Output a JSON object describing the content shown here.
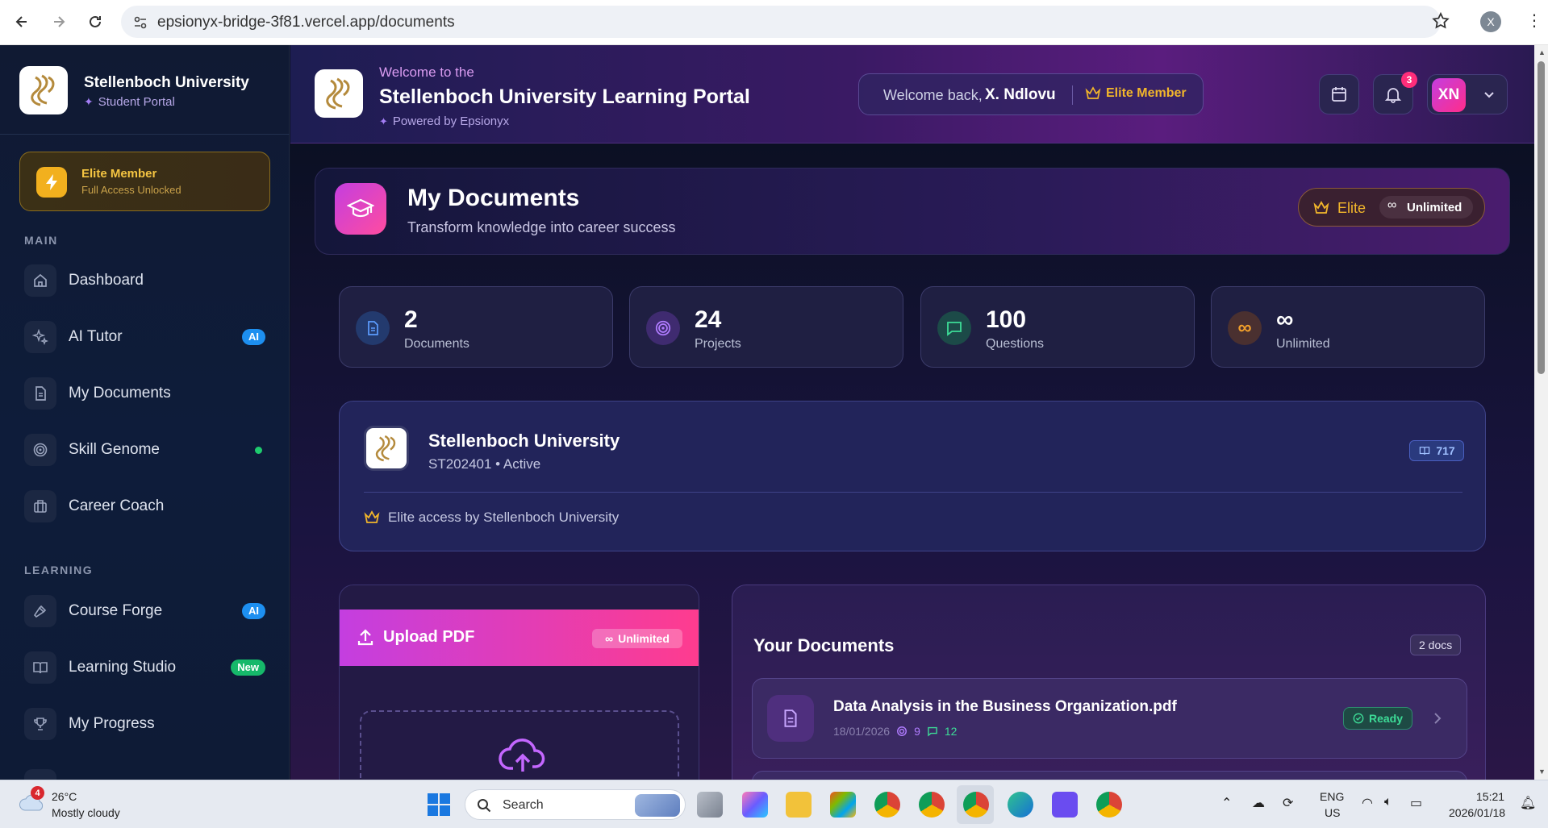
{
  "browser": {
    "url": "epsionyx-bridge-3f81.vercel.app/documents",
    "profile_initial": "X"
  },
  "sidebar": {
    "brand_name": "Stellenboch University",
    "brand_sub": "Student Portal",
    "elite_title": "Elite Member",
    "elite_sub": "Full Access Unlocked",
    "section_main": "MAIN",
    "section_learning": "LEARNING",
    "items": [
      {
        "label": "Dashboard"
      },
      {
        "label": "AI Tutor",
        "badge": "AI"
      },
      {
        "label": "My Documents"
      },
      {
        "label": "Skill Genome"
      },
      {
        "label": "Career Coach"
      },
      {
        "label": "Course Forge",
        "badge": "AI"
      },
      {
        "label": "Learning Studio",
        "badge": "New"
      },
      {
        "label": "My Progress"
      }
    ]
  },
  "header": {
    "welcome_to": "Welcome to the",
    "portal_title": "Stellenboch University Learning Portal",
    "powered_by": "Powered by Epsionyx",
    "welcome_back": "Welcome back,",
    "user_name": "X. Ndlovu",
    "member_label": "Elite Member",
    "notif_count": "3",
    "avatar_initials": "XN"
  },
  "page": {
    "title": "My Documents",
    "subtitle": "Transform knowledge into career success",
    "tier": "Elite",
    "tier_limit": "Unlimited"
  },
  "stats": [
    {
      "value": "2",
      "label": "Documents"
    },
    {
      "value": "24",
      "label": "Projects"
    },
    {
      "value": "100",
      "label": "Questions"
    },
    {
      "value": "∞",
      "label": "Unlimited"
    }
  ],
  "institution": {
    "name": "Stellenboch University",
    "meta": "ST202401 • Active",
    "count": "717",
    "access_note": "Elite access by Stellenboch University"
  },
  "upload": {
    "title": "Upload PDF",
    "badge": "Unlimited"
  },
  "documents": {
    "title": "Your Documents",
    "count_badge": "2 docs",
    "items": [
      {
        "name": "Data Analysis in the Business Organization.pdf",
        "date": "18/01/2026",
        "projects": "9",
        "questions": "12",
        "status": "Ready"
      }
    ]
  },
  "taskbar": {
    "weather_badge": "4",
    "temp": "26°C",
    "weather": "Mostly cloudy",
    "search_placeholder": "Search",
    "lang_top": "ENG",
    "lang_bottom": "US",
    "time": "15:21",
    "date": "2026/01/18"
  },
  "colors": {
    "accent_pink": "#e8389a",
    "gold": "#f2b62b",
    "ready_green": "#3ddc97"
  }
}
